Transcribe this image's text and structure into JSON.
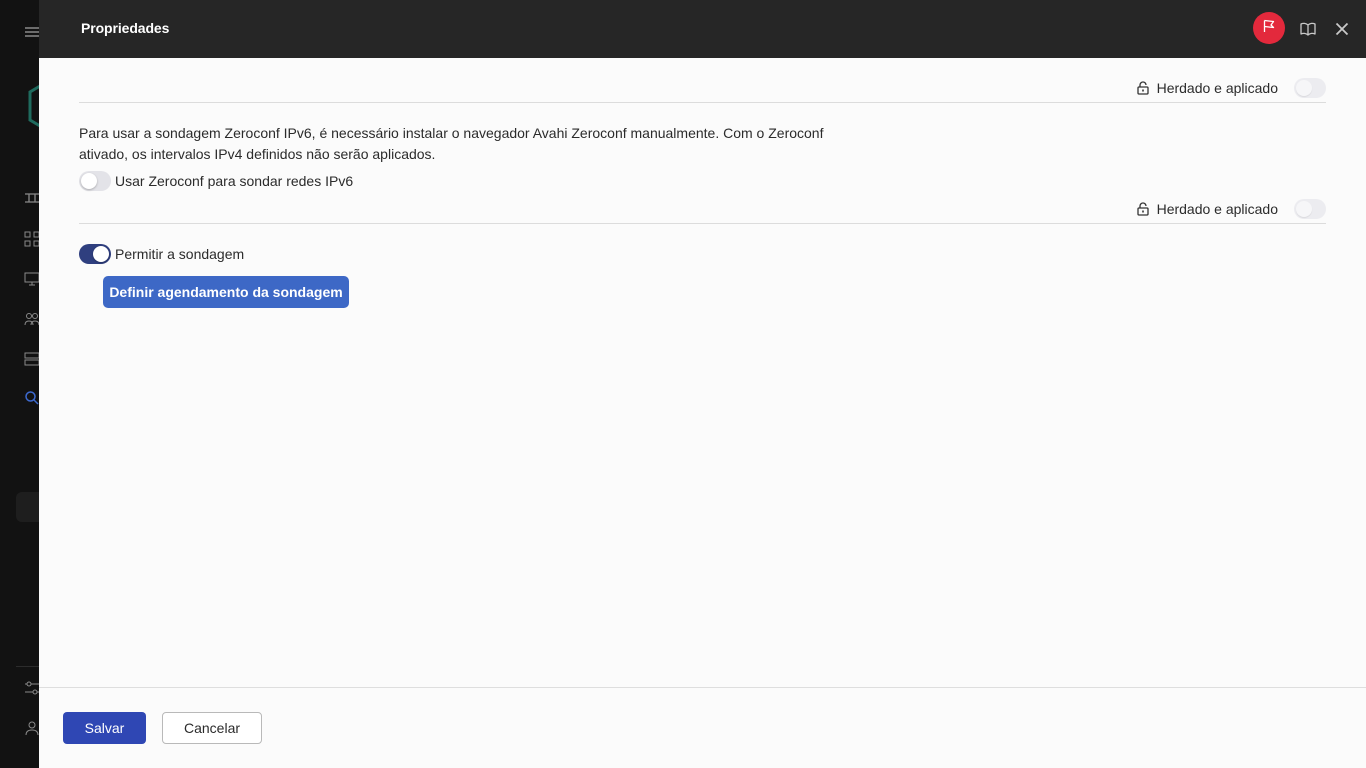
{
  "dialog": {
    "title": "Propriedades"
  },
  "header_icons": [
    "flag-icon",
    "book-icon",
    "close-icon"
  ],
  "sidebar_icons": [
    "menu-icon",
    "app-logo",
    "dashboard-icon",
    "grid-icon",
    "monitor-icon",
    "users-icon",
    "server-icon",
    "search-icon",
    "settings-sliders-icon",
    "user-icon"
  ],
  "section1": {
    "inherit_label": "Herdado e aplicado",
    "inherit_toggle_on": false,
    "description": "Para usar a sondagem Zeroconf IPv6, é necessário instalar o navegador Avahi Zeroconf manualmente. Com o Zeroconf ativado, os intervalos IPv4 definidos não serão aplicados.",
    "zeroconf_toggle_label": "Usar Zeroconf para sondar redes IPv6",
    "zeroconf_toggle_on": false
  },
  "section2": {
    "inherit_label": "Herdado e aplicado",
    "inherit_toggle_on": false,
    "allow_toggle_label": "Permitir a sondagem",
    "allow_toggle_on": true,
    "schedule_button": "Definir agendamento da sondagem"
  },
  "footer": {
    "save_label": "Salvar",
    "cancel_label": "Cancelar"
  },
  "colors": {
    "header_bg": "#262626",
    "flag_red": "#e3293c",
    "primary_button": "#2f47b4",
    "schedule_button": "#3d68c6",
    "toggle_on": "#2f3f7f"
  }
}
